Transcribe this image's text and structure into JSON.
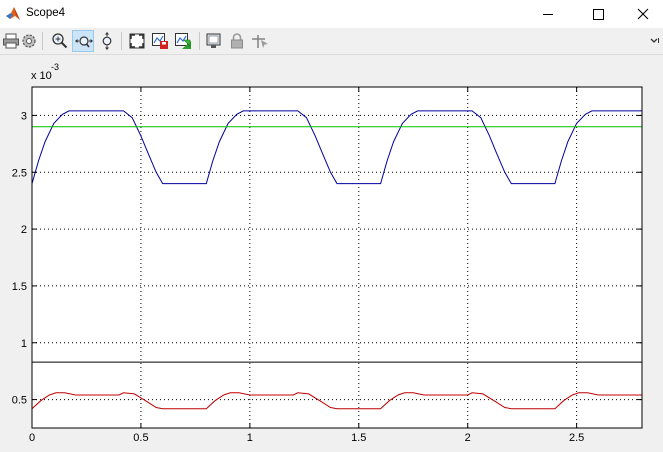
{
  "window": {
    "title": "Scope4",
    "icons": {
      "app": "matlab-icon",
      "minimize": "minimize-icon",
      "maximize": "maximize-icon",
      "close": "close-icon"
    }
  },
  "toolbar": {
    "buttons": [
      {
        "icon": "print-icon",
        "active": false
      },
      {
        "icon": "parameters-gear-icon",
        "active": false
      },
      {
        "icon": "zoom-in-icon",
        "active": false
      },
      {
        "icon": "zoom-x-icon",
        "active": true
      },
      {
        "icon": "zoom-y-icon",
        "active": false
      },
      {
        "icon": "autoscale-icon",
        "active": false
      },
      {
        "icon": "save-axes-settings-icon",
        "active": false
      },
      {
        "icon": "restore-axes-settings-icon",
        "active": false
      },
      {
        "icon": "floating-scope-icon",
        "active": false
      },
      {
        "icon": "lock-axes-icon",
        "active": false
      },
      {
        "icon": "signal-selection-icon",
        "active": false
      }
    ],
    "overflow_icon": "chevron-overflow-icon"
  },
  "chart_data": {
    "type": "line",
    "exponent_label": "x 10",
    "exponent_power": "-3",
    "xlim": [
      0,
      2.8
    ],
    "ylim": [
      0.25,
      3.25
    ],
    "x_ticks": [
      "0",
      "0.5",
      "1",
      "1.5",
      "2",
      "2.5"
    ],
    "x_tick_values": [
      0,
      0.5,
      1,
      1.5,
      2,
      2.5
    ],
    "y_ticks": [
      "0.5",
      "1",
      "1.5",
      "2",
      "2.5",
      "3"
    ],
    "y_tick_values": [
      0.5,
      1,
      1.5,
      2,
      2.5,
      3
    ],
    "grid": true,
    "series": [
      {
        "color": "#0000a0",
        "x": [
          0,
          0.03,
          0.06,
          0.1,
          0.14,
          0.17,
          0.2,
          0.3,
          0.42,
          0.46,
          0.5,
          0.53,
          0.57,
          0.6,
          0.8,
          0.83,
          0.86,
          0.9,
          0.94,
          0.97,
          1.0,
          1.1,
          1.22,
          1.26,
          1.3,
          1.33,
          1.37,
          1.4,
          1.6,
          1.63,
          1.66,
          1.7,
          1.74,
          1.77,
          1.8,
          1.9,
          2.02,
          2.06,
          2.1,
          2.13,
          2.17,
          2.2,
          2.4,
          2.43,
          2.46,
          2.5,
          2.54,
          2.57,
          2.6,
          2.7,
          2.8
        ],
        "y": [
          2.4,
          2.6,
          2.77,
          2.93,
          3.01,
          3.04,
          3.04,
          3.04,
          3.04,
          2.98,
          2.82,
          2.68,
          2.5,
          2.4,
          2.4,
          2.6,
          2.77,
          2.93,
          3.01,
          3.04,
          3.04,
          3.04,
          3.04,
          2.98,
          2.82,
          2.68,
          2.5,
          2.4,
          2.4,
          2.6,
          2.77,
          2.93,
          3.01,
          3.04,
          3.04,
          3.04,
          3.04,
          2.98,
          2.82,
          2.68,
          2.5,
          2.4,
          2.4,
          2.6,
          2.77,
          2.93,
          3.01,
          3.04,
          3.04,
          3.04,
          3.04
        ]
      },
      {
        "color": "#00c000",
        "x": [
          0,
          2.8
        ],
        "y": [
          2.9,
          2.9
        ]
      },
      {
        "color": "#000000",
        "x": [
          0,
          2.8
        ],
        "y": [
          0.83,
          0.83
        ]
      },
      {
        "color": "#c00000",
        "x": [
          0,
          0.04,
          0.08,
          0.11,
          0.15,
          0.2,
          0.4,
          0.42,
          0.47,
          0.53,
          0.57,
          0.6,
          0.8,
          0.84,
          0.88,
          0.91,
          0.95,
          1.0,
          1.2,
          1.22,
          1.27,
          1.33,
          1.37,
          1.4,
          1.6,
          1.64,
          1.68,
          1.71,
          1.75,
          1.8,
          2.0,
          2.02,
          2.07,
          2.13,
          2.17,
          2.2,
          2.4,
          2.44,
          2.48,
          2.51,
          2.55,
          2.6,
          2.8
        ],
        "y": [
          0.42,
          0.49,
          0.54,
          0.56,
          0.56,
          0.54,
          0.54,
          0.56,
          0.55,
          0.48,
          0.43,
          0.42,
          0.42,
          0.49,
          0.54,
          0.56,
          0.56,
          0.54,
          0.54,
          0.56,
          0.55,
          0.48,
          0.43,
          0.42,
          0.42,
          0.49,
          0.54,
          0.56,
          0.56,
          0.54,
          0.54,
          0.56,
          0.55,
          0.48,
          0.43,
          0.42,
          0.42,
          0.49,
          0.54,
          0.56,
          0.56,
          0.54,
          0.54
        ]
      }
    ]
  }
}
